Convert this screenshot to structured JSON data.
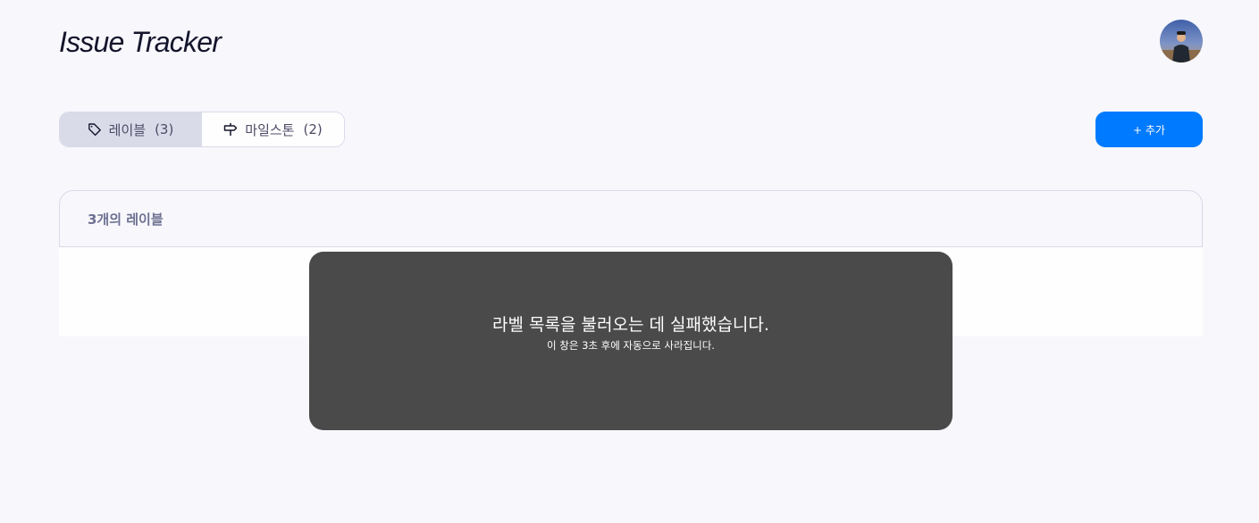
{
  "header": {
    "title": "Issue Tracker",
    "avatar_icon": "user-avatar"
  },
  "tabs": [
    {
      "label": "레이블",
      "count": "(3)",
      "icon": "tag-icon",
      "active": true
    },
    {
      "label": "마일스톤",
      "count": "(2)",
      "icon": "milestone-icon",
      "active": false
    }
  ],
  "toolbar": {
    "add_label": "+ 추가"
  },
  "list": {
    "header_text": "3개의 레이블"
  },
  "toast": {
    "message": "라벨 목록을 불러오는 데 실패했습니다.",
    "sub_message": "이 창은 3초 후에 자동으로 사라집니다."
  },
  "colors": {
    "background": "#f7f7fc",
    "accent": "#007aff",
    "active_tab": "#d9dbe9",
    "toast_bg": "#4a4a4a",
    "border": "#d9dbe9"
  }
}
